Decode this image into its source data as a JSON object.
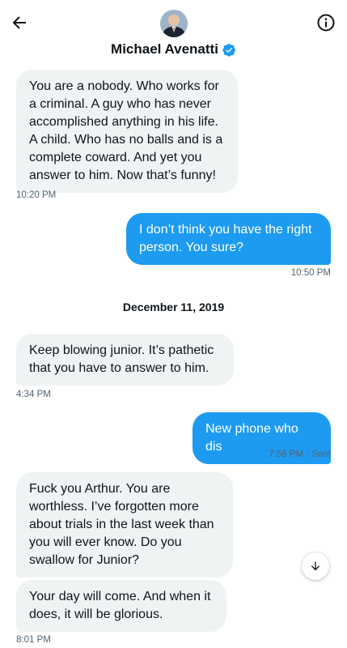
{
  "header": {
    "name": "Michael Avenatti",
    "back_icon": "arrow-left-icon",
    "info_icon": "info-circle-icon",
    "verified_icon": "verified-badge-icon",
    "verified_color": "#1d9bf0"
  },
  "messages": [
    {
      "direction": "in",
      "text": "You are a nobody. Who works for a criminal. A guy who has never accomplished anything in his life. A child. Who has no balls and is a complete coward. And yet you answer to him. Now that’s funny!",
      "time": "10:20 PM"
    },
    {
      "direction": "out",
      "text": "I don’t think you have the right person. You sure?",
      "time": "10:50 PM"
    },
    {
      "direction": "in",
      "text": "Keep blowing junior. It’s pathetic that you have to answer to him.",
      "time": "4:34 PM"
    },
    {
      "direction": "out",
      "text": "New phone who dis",
      "time": "7:56 PM",
      "status": "· Sent"
    },
    {
      "direction": "in",
      "text": "Fuck you Arthur. You are worthless. I’ve forgotten more about trials in the last week than you will ever know. Do you swallow for Junior?"
    },
    {
      "direction": "in",
      "text": "Your day will come. And when it does, it will be glorious.",
      "time": "8:01 PM"
    }
  ],
  "date_separator": "December 11, 2019",
  "scroll_button_icon": "arrow-down-icon",
  "colors": {
    "accent": "#1d9bf0",
    "incoming_bubble": "#eff3f4",
    "secondary_text": "#536471"
  }
}
